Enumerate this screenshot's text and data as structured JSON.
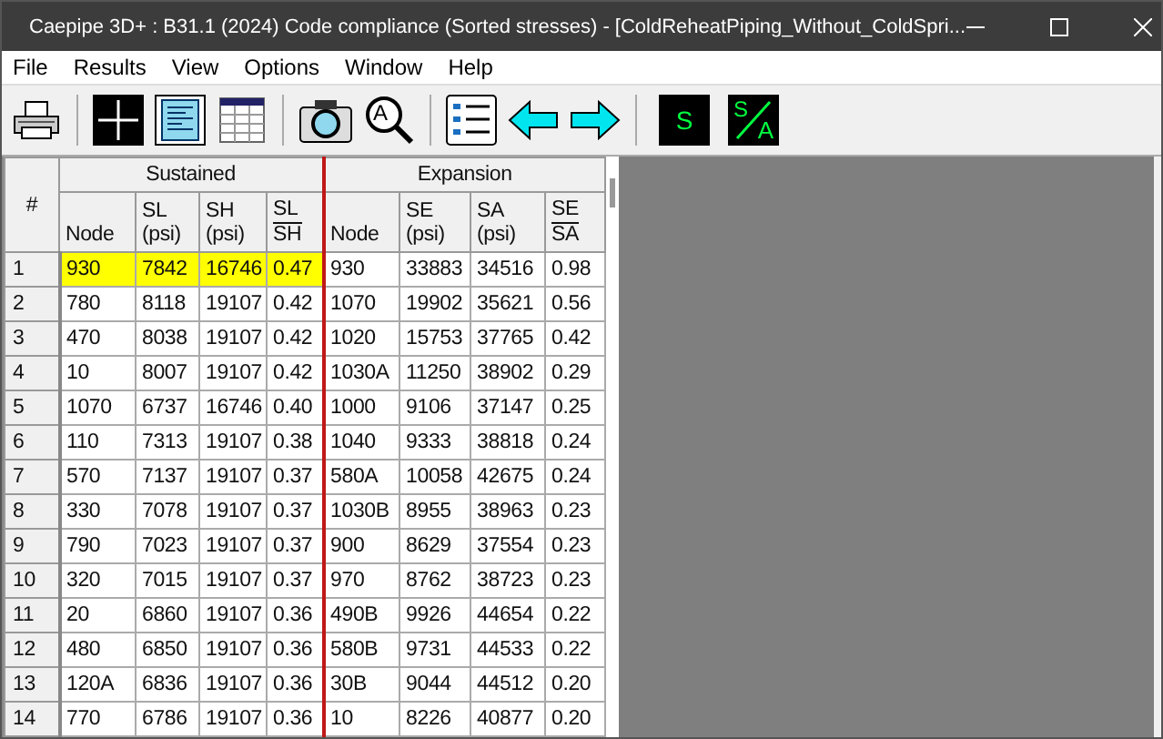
{
  "window": {
    "title": "Caepipe 3D+ : B31.1 (2024) Code compliance (Sorted stresses) -  [ColdReheatPiping_Without_ColdSpri..."
  },
  "menu": [
    "File",
    "Results",
    "View",
    "Options",
    "Window",
    "Help"
  ],
  "toolbar": [
    {
      "kind": "printer"
    },
    {
      "kind": "sep"
    },
    {
      "kind": "crosshair"
    },
    {
      "kind": "document"
    },
    {
      "kind": "table"
    },
    {
      "kind": "sep"
    },
    {
      "kind": "camera"
    },
    {
      "kind": "magnifier",
      "text": "A"
    },
    {
      "kind": "sep"
    },
    {
      "kind": "list"
    },
    {
      "kind": "arrow-left"
    },
    {
      "kind": "arrow-right"
    },
    {
      "kind": "sep"
    },
    {
      "kind": "letter",
      "text": "S"
    },
    {
      "kind": "fraction",
      "top": "S",
      "bottom": "A"
    }
  ],
  "table": {
    "index_header": "#",
    "groups": [
      {
        "label": "Sustained",
        "columns": [
          {
            "kind": "plain",
            "label": "Node"
          },
          {
            "kind": "unit",
            "label": "SL",
            "unit": "(psi)"
          },
          {
            "kind": "unit",
            "label": "SH",
            "unit": "(psi)"
          },
          {
            "kind": "ratio",
            "top": "SL",
            "bottom": "SH"
          }
        ]
      },
      {
        "label": "Expansion",
        "columns": [
          {
            "kind": "plain",
            "label": "Node"
          },
          {
            "kind": "unit",
            "label": "SE",
            "unit": "(psi)"
          },
          {
            "kind": "unit",
            "label": "SA",
            "unit": "(psi)"
          },
          {
            "kind": "ratio",
            "top": "SE",
            "bottom": "SA"
          }
        ]
      }
    ],
    "rows": [
      {
        "index": "1",
        "selected": true,
        "cells": [
          "930",
          "7842",
          "16746",
          "0.47",
          "930",
          "33883",
          "34516",
          "0.98"
        ]
      },
      {
        "index": "2",
        "selected": false,
        "cells": [
          "780",
          "8118",
          "19107",
          "0.42",
          "1070",
          "19902",
          "35621",
          "0.56"
        ]
      },
      {
        "index": "3",
        "selected": false,
        "cells": [
          "470",
          "8038",
          "19107",
          "0.42",
          "1020",
          "15753",
          "37765",
          "0.42"
        ]
      },
      {
        "index": "4",
        "selected": false,
        "cells": [
          "10",
          "8007",
          "19107",
          "0.42",
          "1030A",
          "11250",
          "38902",
          "0.29"
        ]
      },
      {
        "index": "5",
        "selected": false,
        "cells": [
          "1070",
          "6737",
          "16746",
          "0.40",
          "1000",
          "9106",
          "37147",
          "0.25"
        ]
      },
      {
        "index": "6",
        "selected": false,
        "cells": [
          "110",
          "7313",
          "19107",
          "0.38",
          "1040",
          "9333",
          "38818",
          "0.24"
        ]
      },
      {
        "index": "7",
        "selected": false,
        "cells": [
          "570",
          "7137",
          "19107",
          "0.37",
          "580A",
          "10058",
          "42675",
          "0.24"
        ]
      },
      {
        "index": "8",
        "selected": false,
        "cells": [
          "330",
          "7078",
          "19107",
          "0.37",
          "1030B",
          "8955",
          "38963",
          "0.23"
        ]
      },
      {
        "index": "9",
        "selected": false,
        "cells": [
          "790",
          "7023",
          "19107",
          "0.37",
          "900",
          "8629",
          "37554",
          "0.23"
        ]
      },
      {
        "index": "10",
        "selected": false,
        "cells": [
          "320",
          "7015",
          "19107",
          "0.37",
          "970",
          "8762",
          "38723",
          "0.23"
        ]
      },
      {
        "index": "11",
        "selected": false,
        "cells": [
          "20",
          "6860",
          "19107",
          "0.36",
          "490B",
          "9926",
          "44654",
          "0.22"
        ]
      },
      {
        "index": "12",
        "selected": false,
        "cells": [
          "480",
          "6850",
          "19107",
          "0.36",
          "580B",
          "9731",
          "44533",
          "0.22"
        ]
      },
      {
        "index": "13",
        "selected": false,
        "cells": [
          "120A",
          "6836",
          "19107",
          "0.36",
          "30B",
          "9044",
          "44512",
          "0.20"
        ]
      },
      {
        "index": "14",
        "selected": false,
        "cells": [
          "770",
          "6786",
          "19107",
          "0.36",
          "10",
          "8226",
          "40877",
          "0.20"
        ]
      }
    ]
  }
}
